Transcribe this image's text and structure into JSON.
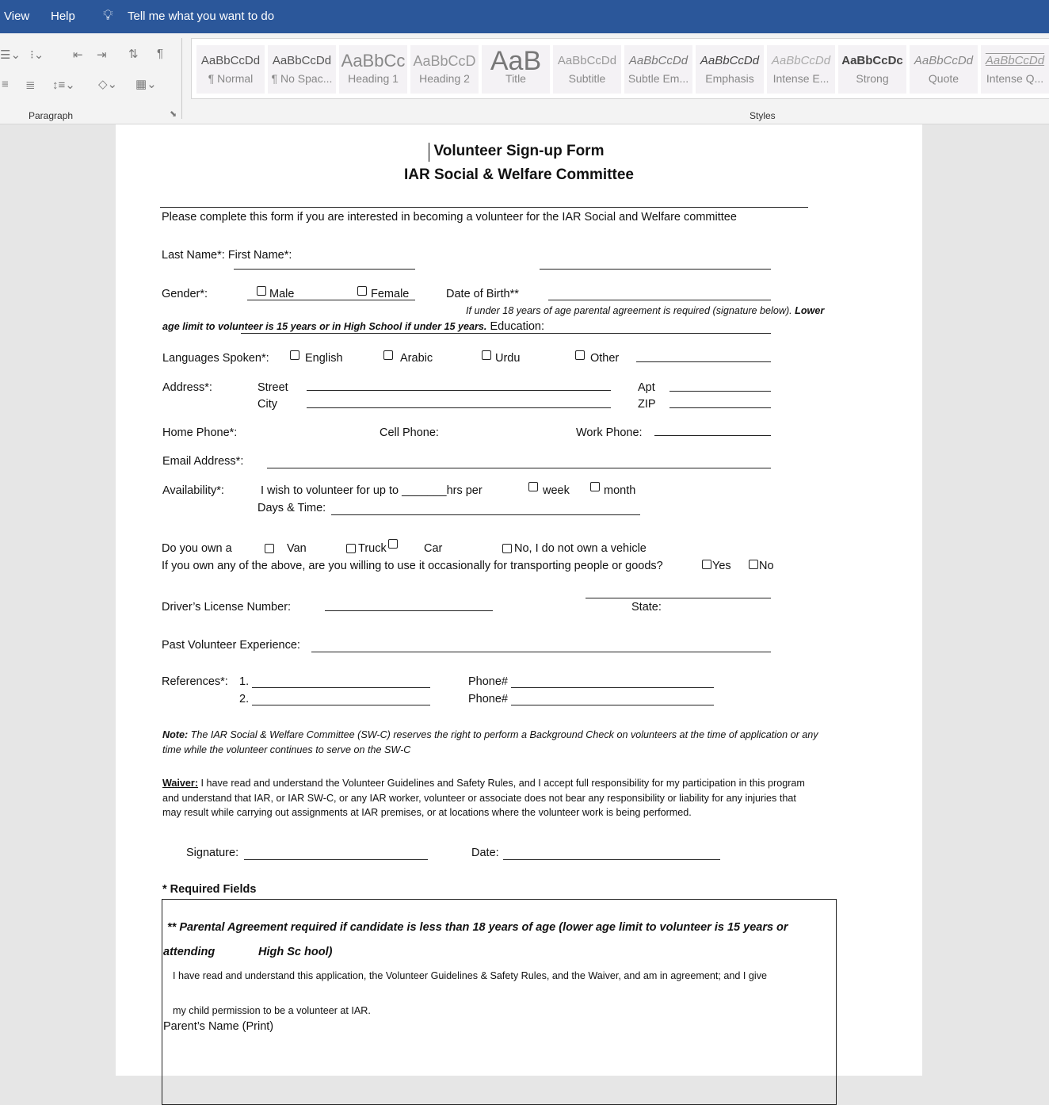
{
  "topbar": {
    "view": "View",
    "help": "Help",
    "tell_me": "Tell me what you want to do"
  },
  "ribbon": {
    "paragraph_label": "Paragraph",
    "styles_label": "Styles",
    "styles": [
      {
        "sample": "AaBbCcDd",
        "label": "¶ Normal"
      },
      {
        "sample": "AaBbCcDd",
        "label": "¶ No Spac..."
      },
      {
        "sample": "AaBbCc",
        "label": "Heading 1"
      },
      {
        "sample": "AaBbCcD",
        "label": "Heading 2"
      },
      {
        "sample": "AaB",
        "label": "Title"
      },
      {
        "sample": "AaBbCcDd",
        "label": "Subtitle"
      },
      {
        "sample": "AaBbCcDd",
        "label": "Subtle Em..."
      },
      {
        "sample": "AaBbCcDd",
        "label": "Emphasis"
      },
      {
        "sample": "AaBbCcDd",
        "label": "Intense E..."
      },
      {
        "sample": "AaBbCcDc",
        "label": "Strong"
      },
      {
        "sample": "AaBbCcDd",
        "label": "Quote"
      },
      {
        "sample": "AaBbCcDd",
        "label": "Intense Q..."
      }
    ]
  },
  "doc": {
    "title": "Volunteer Sign-up Form",
    "subtitle": "IAR Social & Welfare Committee",
    "intro": "Please complete this form if you are interested in becoming a volunteer for the IAR Social and Welfare committee",
    "name_label": "Last Name*:  First Name*:",
    "gender_label": "Gender*:",
    "male": "Male",
    "female": "Female",
    "dob_label": "Date of Birth**",
    "age_note": "If under 18 years of age parental agreement is required (signature below). ",
    "age_note_bold": "Lower",
    "age_limit": "age limit to volunteer is 15 years or in High School if under 15 years.",
    "education": " Education:",
    "languages_label": "Languages Spoken*:",
    "english": "English",
    "arabic": "Arabic",
    "urdu": "Urdu",
    "other": "Other",
    "address_label": "Address*:",
    "street": "Street",
    "city": "City",
    "apt": "Apt",
    "zip": "ZIP",
    "home_phone": "Home Phone*:",
    "cell_phone": "Cell Phone:",
    "work_phone": "Work Phone:",
    "email": "Email Address*:",
    "availability": "Availability*:",
    "wish": "I wish to volunteer for up to _______hrs per",
    "week": "week",
    "month": "month",
    "days_time": "Days & Time:",
    "own": "Do you own a",
    "van": "Van",
    "truck": "Truck",
    "car": "Car",
    "no_vehicle": "No, I do not own a vehicle",
    "transport_q": "If you own any of the above, are you willing to use it occasionally for transporting people or goods?",
    "yes": "Yes",
    "no": "No",
    "license": "Driver’s License Number:",
    "state": "State:",
    "past_exp": "Past Volunteer Experience:",
    "references": "References*:",
    "ref1": "1.",
    "ref2": "2.",
    "phone": "Phone#",
    "note_label": "Note:",
    "note_1": " The IAR Social & Welfare Committee (SW-C) reserves the right to perform a Background Check on volunteers at the time of application or any",
    "note_2": "time while the volunteer continues to serve on the SW-C",
    "waiver_label": "Waiver:",
    "waiver_1": " I have read and understand the Volunteer Guidelines and Safety Rules, and I accept full responsibility for my participation in this program",
    "waiver_2": "and understand that IAR, or IAR SW-C, or any IAR worker, volunteer or associate does not bear any responsibility or liability for any injuries that",
    "waiver_3": "may result while carrying out assignments at IAR premises, or at locations where the volunteer work is being performed.",
    "signature": "Signature:",
    "date": "Date:",
    "required": "* Required Fields",
    "parental_1": "** Parental Agreement required if candidate is less than 18 years of age (lower age limit to volunteer is 15 years or",
    "parental_2a": "attending",
    "parental_2b": "High Sc hool)",
    "consent_1": "I have read and understand this application, the Volunteer Guidelines & Safety Rules, and the Waiver, and am in agreement; and I give",
    "consent_2": "my child permission to be a volunteer at IAR.",
    "parent_name": "Parent’s  Name (Print)"
  }
}
